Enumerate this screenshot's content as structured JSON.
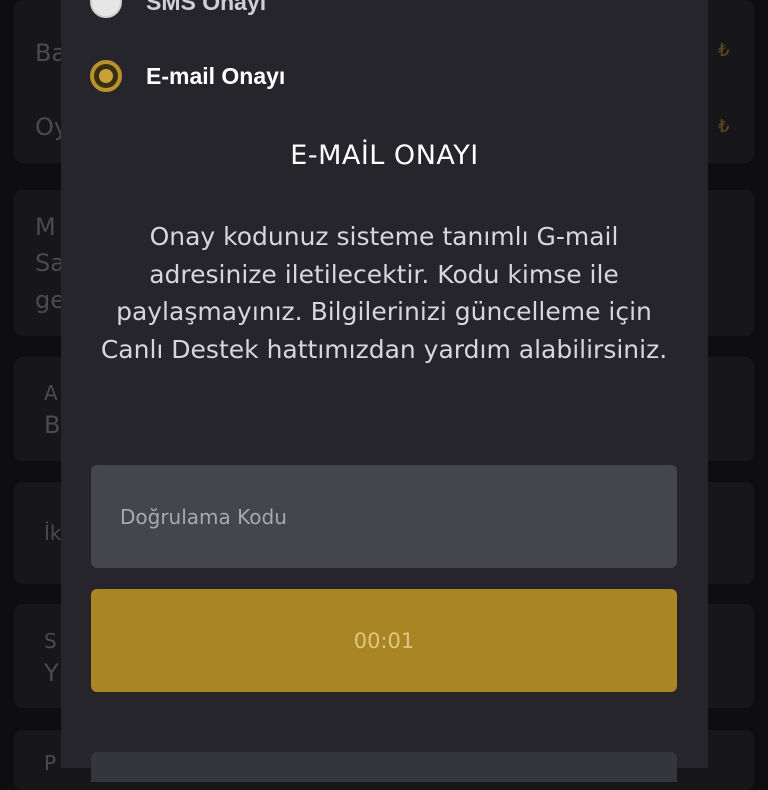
{
  "modal": {
    "options": [
      {
        "label": "SMS Onayı",
        "selected": false
      },
      {
        "label": "E-mail Onayı",
        "selected": true
      }
    ],
    "title": "E-MAİL ONAYI",
    "description": "Onay kodunuz sisteme tanımlı G-mail adresinize iletilecektir. Kodu kimse ile paylaşmayınız. Bilgilerinizi güncelleme için Canlı Destek hattımızdan yardım alabilirsiniz.",
    "code_input": {
      "placeholder": "Doğrulama Kodu",
      "value": ""
    },
    "timer_button": {
      "label": "00:01"
    }
  },
  "background": {
    "fragments": [
      "Ba",
      "Oy",
      "M",
      "Sa",
      "ge",
      "A",
      "B",
      "İk",
      "S",
      "Y",
      "P"
    ],
    "currency": "₺"
  },
  "colors": {
    "accent": "#a98524",
    "modal_bg": "#25252b",
    "input_bg": "#45454d",
    "page_bg": "#0e0e10"
  }
}
